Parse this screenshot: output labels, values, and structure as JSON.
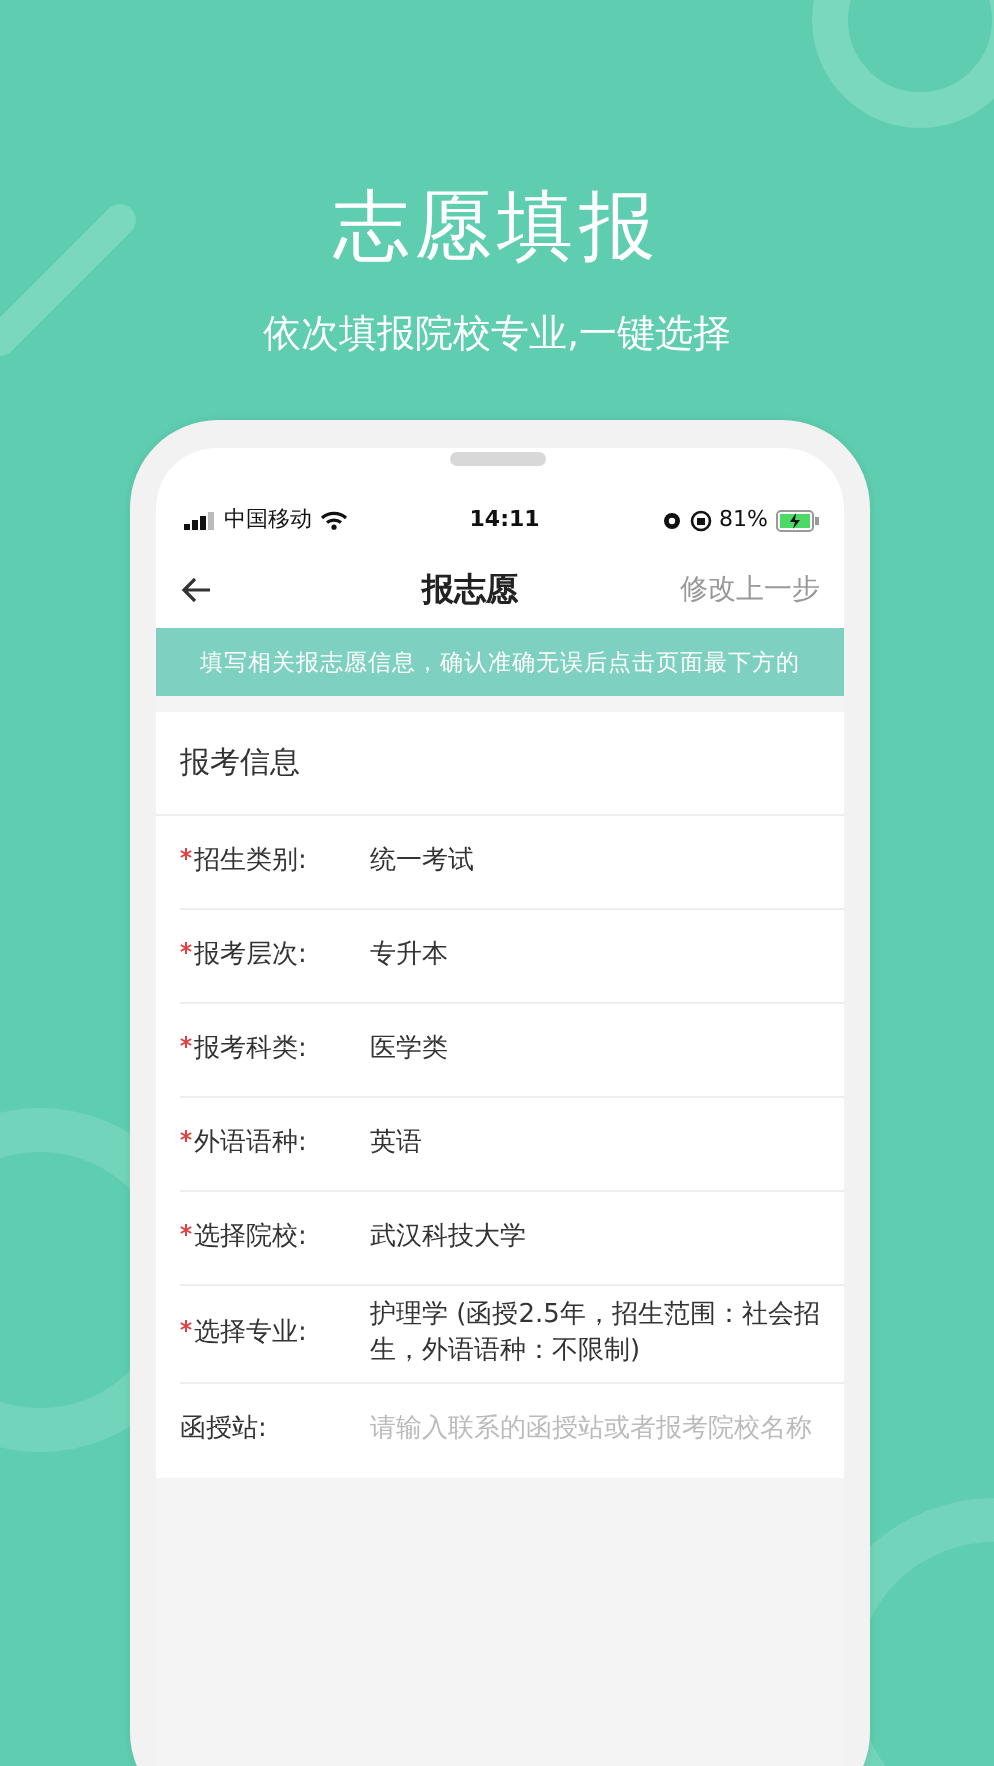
{
  "headline": "志愿填报",
  "subheadline": "依次填报院校专业,一键选择",
  "status_bar": {
    "carrier": "中国移动",
    "time": "14:11",
    "battery": "81%"
  },
  "nav": {
    "title": "报志愿",
    "action": "修改上一步"
  },
  "notice": "填写相关报志愿信息，确认准确无误后点击页面最下方的",
  "section_title": "报考信息",
  "fields": [
    {
      "label": "招生类别:",
      "value": "统一考试",
      "required": true
    },
    {
      "label": "报考层次:",
      "value": "专升本",
      "required": true
    },
    {
      "label": "报考科类:",
      "value": "医学类",
      "required": true
    },
    {
      "label": "外语语种:",
      "value": "英语",
      "required": true
    },
    {
      "label": "选择院校:",
      "value": "武汉科技大学",
      "required": true
    },
    {
      "label": "选择专业:",
      "value": "护理学 (函授2.5年，招生范围：社会招生，外语语种：不限制)",
      "required": true
    },
    {
      "label": "函授站:",
      "placeholder": "请输入联系的函授站或者报考院校名称",
      "required": false
    }
  ]
}
